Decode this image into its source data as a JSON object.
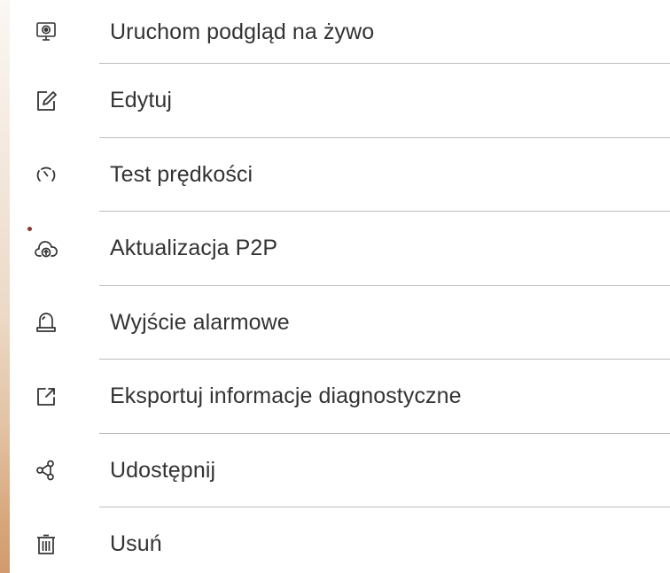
{
  "menu": {
    "items": [
      {
        "label": "Uruchom podgląd na żywo",
        "icon": "monitor-icon"
      },
      {
        "label": "Edytuj",
        "icon": "edit-icon"
      },
      {
        "label": "Test prędkości",
        "icon": "speedometer-icon"
      },
      {
        "label": "Aktualizacja P2P",
        "icon": "cloud-upload-icon",
        "has_notification_dot": true
      },
      {
        "label": "Wyjście alarmowe",
        "icon": "alarm-light-icon"
      },
      {
        "label": "Eksportuj informacje diagnostyczne",
        "icon": "export-icon"
      },
      {
        "label": "Udostępnij",
        "icon": "share-icon"
      },
      {
        "label": "Usuń",
        "icon": "trash-icon"
      }
    ]
  },
  "colors": {
    "text": "#333333",
    "divider": "#bdbdbd",
    "notification_dot": "#8a3a2a",
    "background": "#ffffff"
  }
}
